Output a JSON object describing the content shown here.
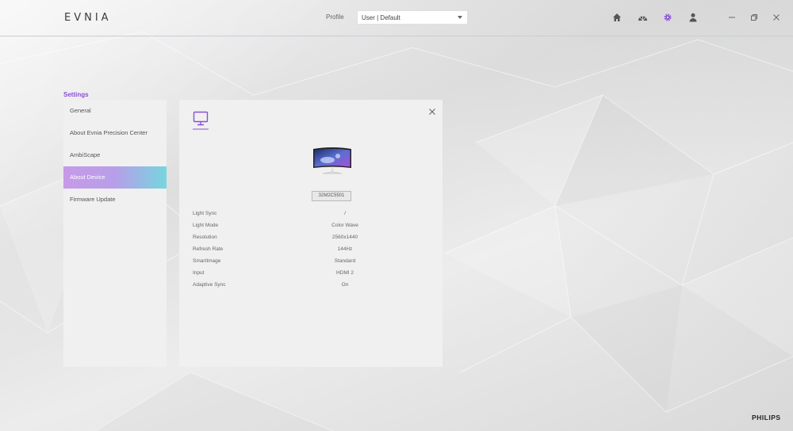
{
  "app": {
    "logo": "EVNIA",
    "brand": "PHILIPS"
  },
  "header": {
    "profile_label": "Profile",
    "profile_value": "User | Default",
    "icons": [
      "home-icon",
      "ambiglow-icon",
      "gear-icon",
      "user-icon"
    ],
    "active_icon": "gear-icon"
  },
  "colors": {
    "accent": "#8a4fd6",
    "active_gradient_start": "#c79ae8",
    "active_gradient_end": "#76d6df"
  },
  "settings": {
    "title": "Settings",
    "menu": [
      {
        "label": "General",
        "active": false
      },
      {
        "label": "About Evnia Precision Center",
        "active": false
      },
      {
        "label": "AmbiScape",
        "active": false
      },
      {
        "label": "About Device",
        "active": true
      },
      {
        "label": "Firmware Update",
        "active": false
      }
    ]
  },
  "device": {
    "model": "32M2C5501",
    "specs": [
      {
        "label": "Light Sync",
        "value": "/"
      },
      {
        "label": "Light Mode",
        "value": "Color Wave"
      },
      {
        "label": "Resolution",
        "value": "2560x1440"
      },
      {
        "label": "Refresh Rate",
        "value": "144Hz"
      },
      {
        "label": "SmartImage",
        "value": "Standard"
      },
      {
        "label": "Input",
        "value": "HDMI 2"
      },
      {
        "label": "Adaptive Sync",
        "value": "On"
      }
    ]
  }
}
